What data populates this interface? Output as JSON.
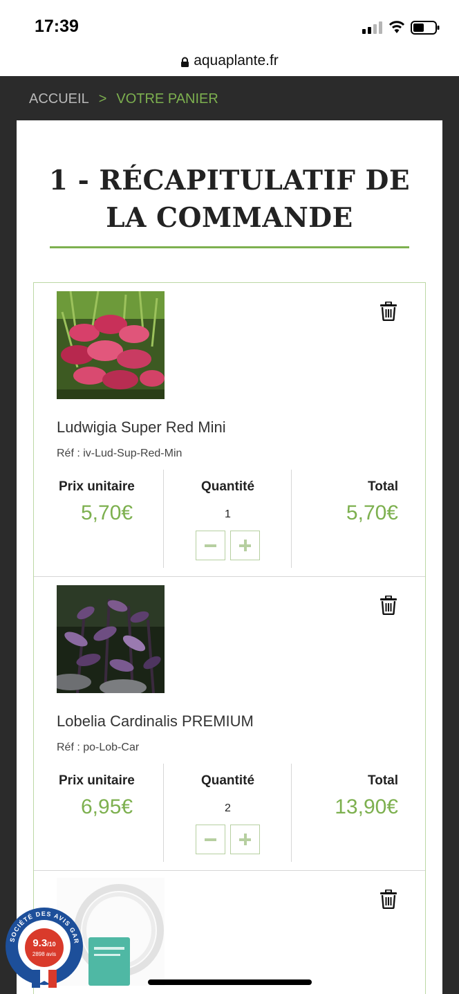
{
  "status_bar": {
    "time": "17:39"
  },
  "browser": {
    "url": "aquaplante.fr"
  },
  "breadcrumb": {
    "home": "ACCUEIL",
    "separator": ">",
    "current": "VOTRE PANIER"
  },
  "page": {
    "title_line1": "1 - RÉCAPITULATIF DE",
    "title_line2": "LA COMMANDE"
  },
  "labels": {
    "unit_price": "Prix unitaire",
    "quantity": "Quantité",
    "total": "Total",
    "ref_prefix": "Réf :"
  },
  "items": [
    {
      "name": "Ludwigia Super Red Mini",
      "ref": "Réf : iv-Lud-Sup-Red-Min",
      "unit_price": "5,70€",
      "quantity": "1",
      "total": "5,70€",
      "image_icon": "red-plant-photo"
    },
    {
      "name": "Lobelia Cardinalis PREMIUM",
      "ref": "Réf : po-Lob-Car",
      "unit_price": "6,95€",
      "quantity": "2",
      "total": "13,90€",
      "image_icon": "purple-plant-photo"
    },
    {
      "image_icon": "tube-product-photo"
    }
  ],
  "badge": {
    "arc_text": "SOCIÉTÉ DES AVIS GARANTIS",
    "score": "9.3",
    "score_suffix": "/10",
    "reviews": "2898 avis"
  },
  "colors": {
    "accent": "#7db04f",
    "dark_bg": "#2b2b2b",
    "badge_blue": "#1d4f9a",
    "badge_red": "#d93a2b"
  }
}
